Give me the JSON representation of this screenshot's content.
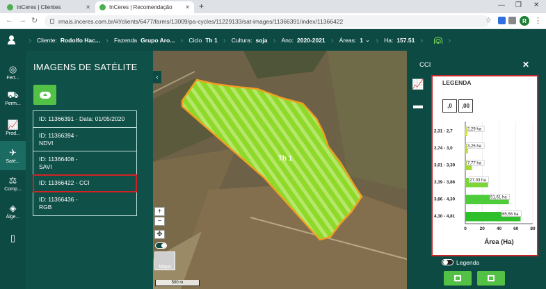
{
  "browser": {
    "tabs": [
      {
        "title": "InCeres | Clientes"
      },
      {
        "title": "InCeres | Recomendação"
      }
    ],
    "url": "rmais.inceres.com.br/#!/clients/6477/farms/13009/pa-cycles/11229133/sat-images/11366391/index/11366422",
    "profile_initial": "R"
  },
  "header": {
    "items": [
      {
        "label": "Cliente:",
        "value": "Rodolfo Hac..."
      },
      {
        "label": "Fazenda",
        "value": "Grupo Aro..."
      },
      {
        "label": "Ciclo",
        "value": "Th 1"
      },
      {
        "label": "Cultura:",
        "value": "soja"
      },
      {
        "label": "Ano:",
        "value": "2020-2021"
      },
      {
        "label": "Áreas:",
        "value": "1"
      },
      {
        "label": "Ha:",
        "value": "157.51"
      }
    ]
  },
  "nav": {
    "items": [
      {
        "label": "Fert...",
        "icon": "fertilizer-icon"
      },
      {
        "label": "Perm...",
        "icon": "machine-icon"
      },
      {
        "label": "Prod...",
        "icon": "line-chart-icon"
      },
      {
        "label": "Saté...",
        "icon": "satellite-icon"
      },
      {
        "label": "Comp...",
        "icon": "compare-icon"
      },
      {
        "label": "Álge...",
        "icon": "layers-icon"
      },
      {
        "label": "",
        "icon": "sim-card-icon"
      }
    ]
  },
  "images_panel": {
    "title": "IMAGENS DE SATÉLITE",
    "items": [
      {
        "line1": "ID: 11366391 - Data: 01/05/2020",
        "line2": ""
      },
      {
        "line1": "ID: 11366394 -",
        "line2": "NDVI"
      },
      {
        "line1": "ID: 11366408 -",
        "line2": "SAVI"
      },
      {
        "line1": "ID: 11366422 - CCI",
        "line2": ""
      },
      {
        "line1": "ID: 11366436 -",
        "line2": "RGB"
      }
    ],
    "selected_index": 3
  },
  "map": {
    "field_label": "Th 1",
    "scale_label": "500 m",
    "thumb_label": "Mapa"
  },
  "cci_panel": {
    "title": "CCI",
    "legend_title": "LEGENDA",
    "decimal_buttons": [
      ",0",
      ",00"
    ],
    "legend_toggle_label": "Legenda"
  },
  "chart_data": {
    "type": "bar",
    "orientation": "horizontal",
    "categories": [
      "2,31 - 2,74",
      "2,74 - 3,01",
      "3,01 - 3,39",
      "3,39 - 3,86",
      "3,86 - 4,30",
      "4,30 - 4,81"
    ],
    "category_labels": [
      "2,31 - 2,7",
      "2,74 - 3,0",
      "3,01 - 3,39",
      "3,39 - 3,86",
      "3,86 - 4,30",
      "4,30 - 4,81"
    ],
    "values": [
      2.29,
      3.25,
      7.77,
      27.03,
      51.61,
      65.56
    ],
    "data_labels": [
      "2,29 ha",
      "3,25 ha",
      "7,77 ha",
      "27,03 ha",
      "51,61 ha",
      "65,56 ha"
    ],
    "colors": [
      "#d8e820",
      "#c3e02a",
      "#a6db34",
      "#7bd63a",
      "#4fcc3a",
      "#2fbf2a"
    ],
    "xlabel": "Área (Ha)",
    "xlim": [
      0,
      80
    ],
    "xticks": [
      0,
      20,
      40,
      60,
      80
    ]
  },
  "colors": {
    "header_bg": "#0e4a44",
    "panel_bg": "#0f5048",
    "accent_green": "#53c146",
    "highlight_red": "#d02226"
  }
}
